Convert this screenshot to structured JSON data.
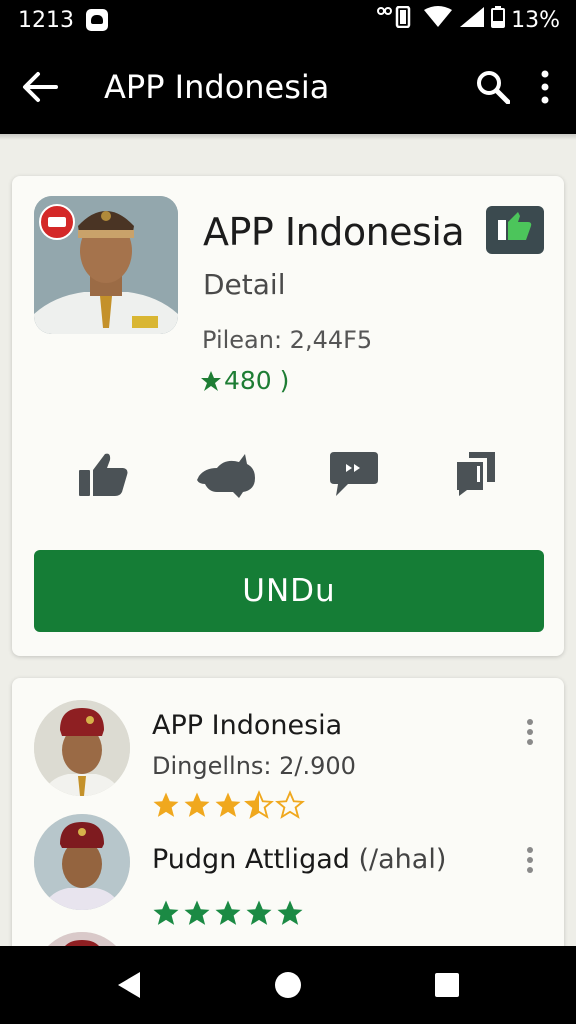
{
  "status_bar": {
    "time": "1213",
    "battery": "13%"
  },
  "app_bar": {
    "title": "APP Indonesia"
  },
  "detail": {
    "title": "APP Indonesia",
    "subtitle": "Detail",
    "meta": "Pilean: 2,44F5",
    "rating": "480 )",
    "install_label": "UNDu",
    "actions": [
      "thumb-up-icon",
      "cat-icon",
      "chat-icon",
      "copy-icon"
    ]
  },
  "list": {
    "items": [
      {
        "title": "APP Indonesia",
        "subtitle": "Dingellns: 2/.900",
        "stars": 3.5
      },
      {
        "title": "Pudgn Attligad",
        "title_suffix": "(/ahal)",
        "stars": 5
      }
    ]
  },
  "colors": {
    "primary_green": "#157d36",
    "star_gold": "#f0a81e",
    "star_green": "#1b8a44",
    "app_bar": "#000000"
  }
}
